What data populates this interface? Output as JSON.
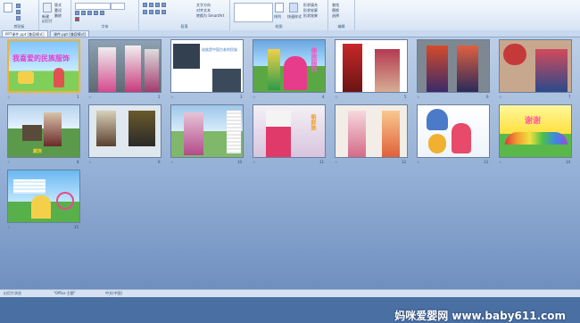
{
  "ribbon": {
    "groups": [
      {
        "label": "剪贴板"
      },
      {
        "label": "字体"
      },
      {
        "label": "段落"
      },
      {
        "label": "绘图"
      },
      {
        "label": "编辑"
      }
    ],
    "items": {
      "new_slide": "新建",
      "slide": "幻灯片",
      "layout": "版式",
      "reset": "重设",
      "delete": "删除",
      "find": "查找",
      "replace": "替换",
      "select": "选择",
      "text_direction": "文字方向",
      "align_text": "对齐文本",
      "smartart": "转换为 SmartArt",
      "arrange": "排列",
      "quick_styles": "快速样式",
      "shape_fill": "形状填充",
      "shape_outline": "形状轮廓",
      "shape_effects": "形状效果"
    }
  },
  "doc_tabs": [
    {
      "label": "PPT课件.ppt [兼容模式]"
    },
    {
      "label": "课件.ppt [兼容模式]"
    }
  ],
  "slides": [
    {
      "num": "1",
      "title": "我喜爱的民族服饰"
    },
    {
      "num": "2"
    },
    {
      "num": "3",
      "text": "苗族是中国古老的民族"
    },
    {
      "num": "4",
      "title": "傣族服饰"
    },
    {
      "num": "5"
    },
    {
      "num": "6"
    },
    {
      "num": "7"
    },
    {
      "num": "8",
      "title": "藏族"
    },
    {
      "num": "9"
    },
    {
      "num": "10"
    },
    {
      "num": "11",
      "title": "朝鲜族"
    },
    {
      "num": "12"
    },
    {
      "num": "13"
    },
    {
      "num": "14",
      "title": "谢谢"
    },
    {
      "num": "15"
    }
  ],
  "status": {
    "slide_info": "幻灯片浏览",
    "theme": "\"Office 主题\"",
    "language": "中文(中国)"
  },
  "watermark": "妈咪爱婴网 www.baby611.com",
  "colors": {
    "accent": "#f2b233",
    "background": "#93afd5"
  }
}
